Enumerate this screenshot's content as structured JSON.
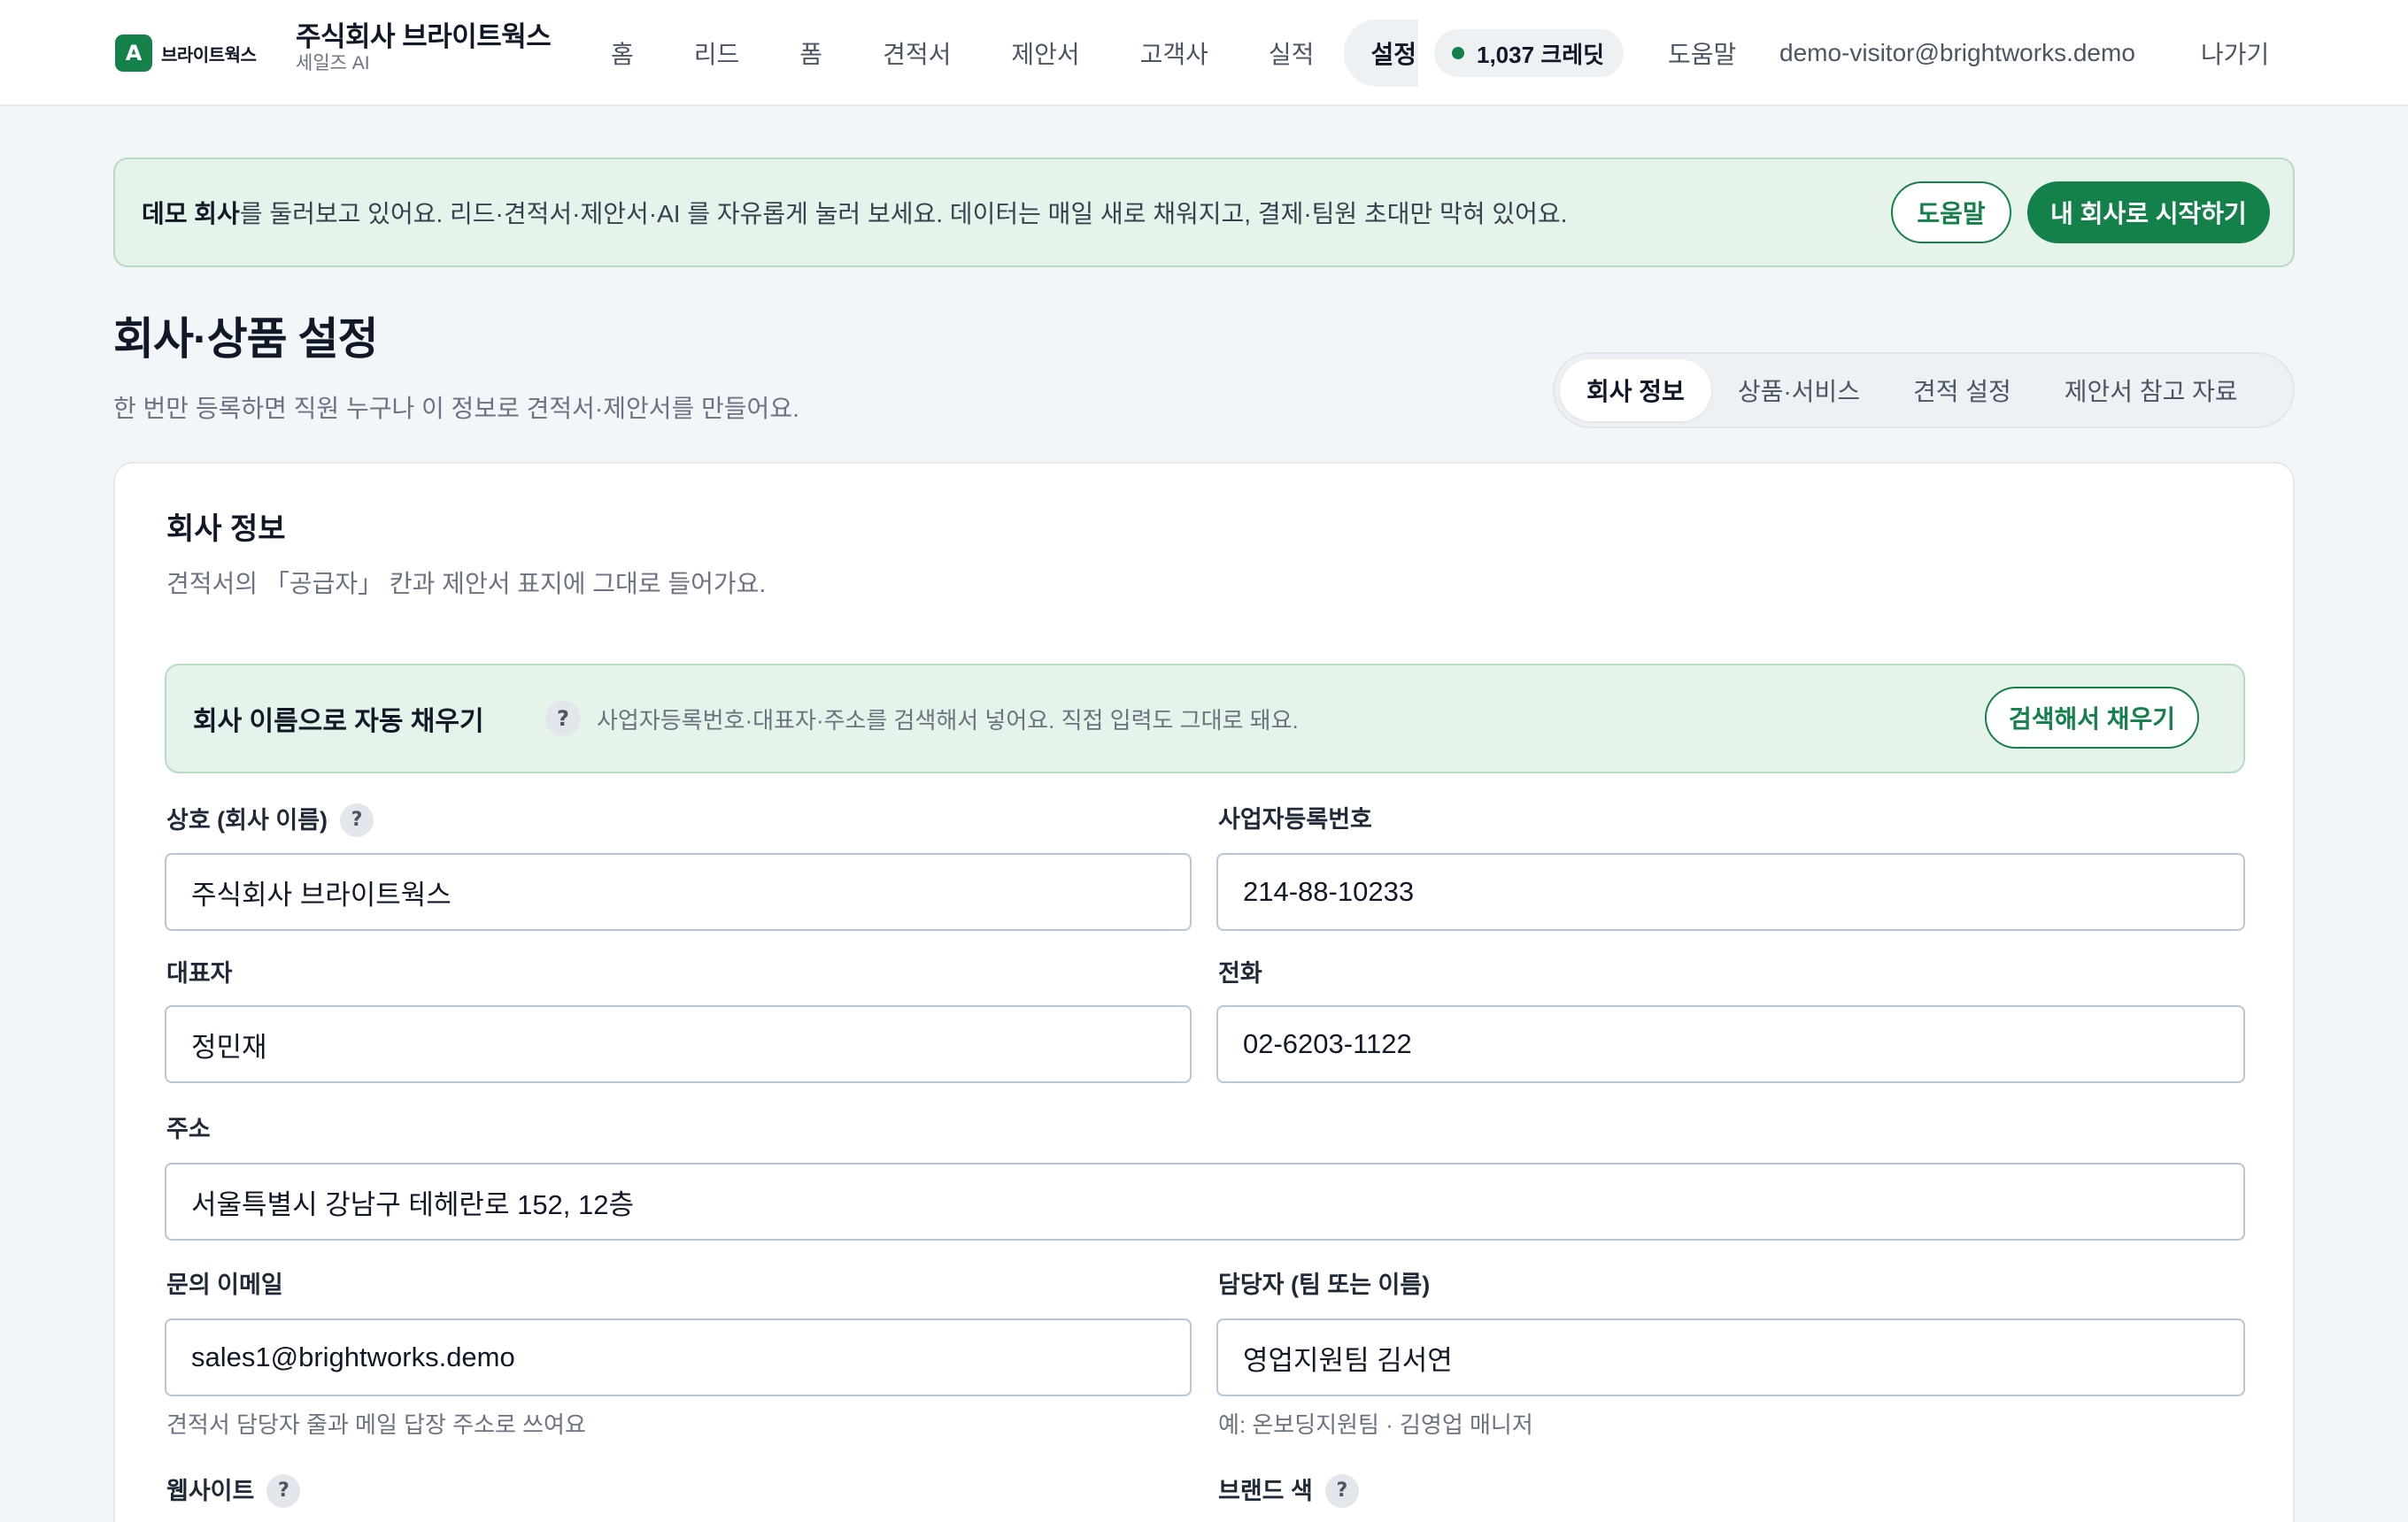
{
  "brand": {
    "logo_mark": "A",
    "logo_text": "브라이트웍스",
    "accent_color": "#14804a"
  },
  "org": {
    "name": "주식회사 브라이트웍스",
    "product": "세일즈 AI"
  },
  "nav": {
    "items": [
      "홈",
      "리드",
      "폼",
      "견적서",
      "제안서",
      "고객사",
      "실적"
    ],
    "active": "설정",
    "credits": "1,037 크레딧",
    "help": "도움말",
    "account_email": "demo-visitor@brightworks.demo",
    "exit": "나가기"
  },
  "banner": {
    "bold": "데모 회사",
    "text": "를 둘러보고 있어요. 리드·견적서·제안서·AI 를 자유롭게 눌러 보세요. 데이터는 매일 새로 채워지고, 결제·팀원 초대만 막혀 있어요.",
    "help_button": "도움말",
    "start_button": "내 회사로 시작하기"
  },
  "page": {
    "title": "회사·상품 설정",
    "subtitle": "한 번만 등록하면 직원 누구나 이 정보로 견적서·제안서를 만들어요."
  },
  "tabs": [
    "회사 정보",
    "상품·서비스",
    "견적 설정",
    "제안서 참고 자료"
  ],
  "card": {
    "title": "회사 정보",
    "subtitle": "견적서의 「공급자」 칸과 제안서 표지에 그대로 들어가요."
  },
  "autofill": {
    "title": "회사 이름으로 자동 채우기",
    "help": "?",
    "description": "사업자등록번호·대표자·주소를 검색해서 넣어요. 직접 입력도 그대로 돼요.",
    "button": "검색해서 채우기"
  },
  "fields": {
    "company_name": {
      "label": "상호 (회사 이름)",
      "help": "?",
      "value": "주식회사 브라이트웍스"
    },
    "biz_number": {
      "label": "사업자등록번호",
      "value": "214-88-10233"
    },
    "ceo": {
      "label": "대표자",
      "value": "정민재"
    },
    "phone": {
      "label": "전화",
      "value": "02-6203-1122"
    },
    "address": {
      "label": "주소",
      "value": "서울특별시 강남구 테헤란로 152, 12층"
    },
    "email": {
      "label": "문의 이메일",
      "value": "sales1@brightworks.demo",
      "hint": "견적서 담당자 줄과 메일 답장 주소로 쓰여요"
    },
    "contact": {
      "label": "담당자 (팀 또는 이름)",
      "value": "영업지원팀 김서연",
      "hint": "예: 온보딩지원팀 · 김영업 매니저"
    },
    "website": {
      "label": "웹사이트",
      "help": "?"
    },
    "brand_color": {
      "label": "브랜드 색",
      "help": "?"
    }
  }
}
